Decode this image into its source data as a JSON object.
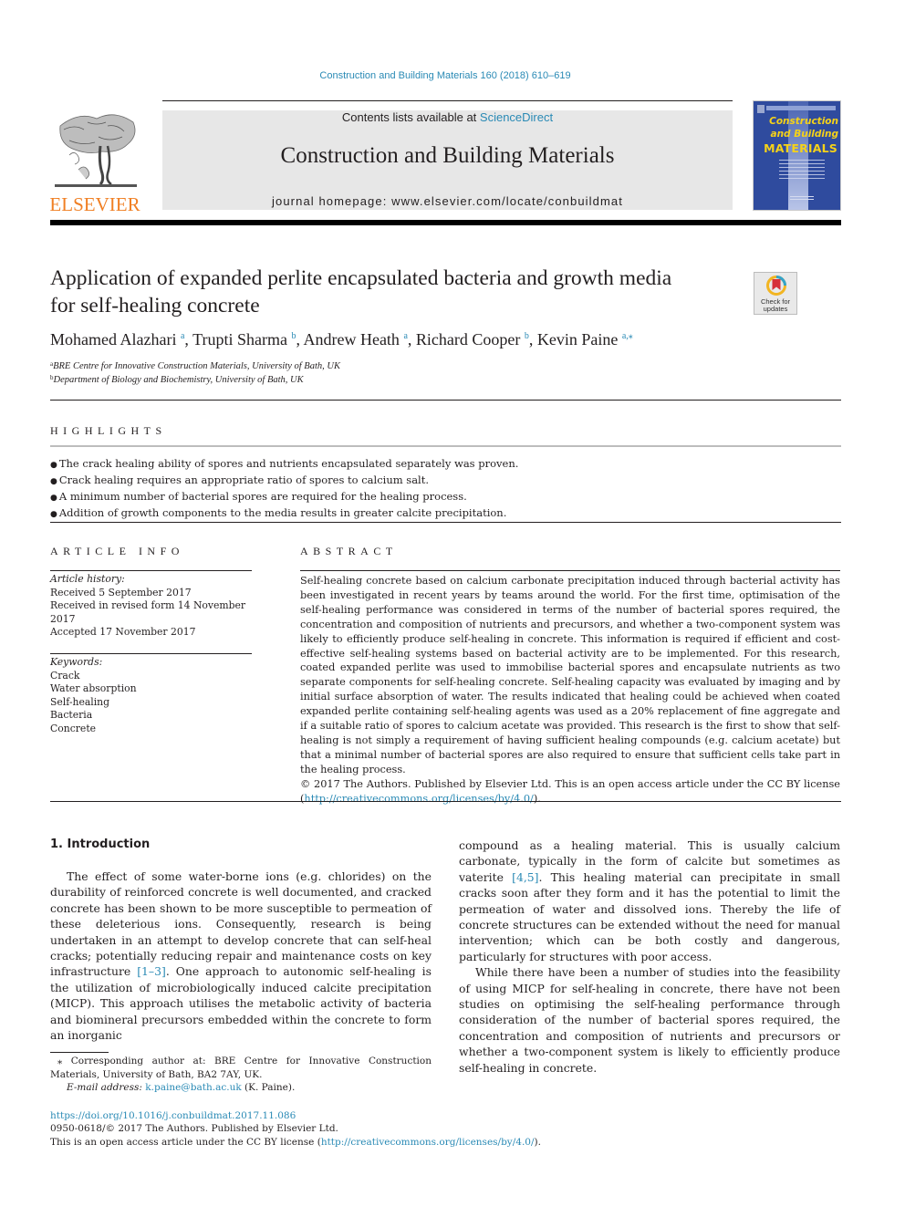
{
  "running_head": "Construction and Building Materials 160 (2018) 610–619",
  "masthead": {
    "contents_prefix": "Contents lists available at ",
    "contents_link": "ScienceDirect",
    "journal_name": "Construction and Building Materials",
    "homepage": "journal homepage: www.elsevier.com/locate/conbuildmat",
    "publisher_logo_text": "ELSEVIER",
    "cover": {
      "title_line1": "Construction",
      "title_line2": "and Building",
      "title_line3": "MATERIALS"
    }
  },
  "colors": {
    "link": "#2a8ab5",
    "elsevier_orange": "#f07f23",
    "cover_blue": "#2f4b9e",
    "cover_yellow": "#f5d219",
    "masthead_grey": "#e7e7e7"
  },
  "check_updates": {
    "line1": "Check for",
    "line2": "updates"
  },
  "article": {
    "title_line1": "Application of expanded perlite encapsulated bacteria and growth media",
    "title_line2": "for self-healing concrete",
    "authors": [
      {
        "name": "Mohamed Alazhari",
        "sup": "a"
      },
      {
        "name": "Trupti Sharma",
        "sup": "b"
      },
      {
        "name": "Andrew Heath",
        "sup": "a"
      },
      {
        "name": "Richard Cooper",
        "sup": "b"
      },
      {
        "name": "Kevin Paine",
        "sup": "a,⁎"
      }
    ],
    "affiliations": [
      {
        "sup": "a",
        "text": "BRE Centre for Innovative Construction Materials, University of Bath, UK"
      },
      {
        "sup": "b",
        "text": "Department of Biology and Biochemistry, University of Bath, UK"
      }
    ]
  },
  "highlights": {
    "label": "HIGHLIGHTS",
    "items": [
      "The crack healing ability of spores and nutrients encapsulated separately was proven.",
      "Crack healing requires an appropriate ratio of spores to calcium salt.",
      "A minimum number of bacterial spores are required for the healing process.",
      "Addition of growth components to the media results in greater calcite precipitation."
    ]
  },
  "article_info": {
    "label": "ARTICLE INFO",
    "history_label": "Article history:",
    "history": [
      "Received 5 September 2017",
      "Received in revised form 14 November 2017",
      "Accepted 17 November 2017"
    ],
    "keywords_label": "Keywords:",
    "keywords": [
      "Crack",
      "Water absorption",
      "Self-healing",
      "Bacteria",
      "Concrete"
    ]
  },
  "abstract": {
    "label": "ABSTRACT",
    "text": "Self-healing concrete based on calcium carbonate precipitation induced through bacterial activity has been investigated in recent years by teams around the world. For the first time, optimisation of the self-healing performance was considered in terms of the number of bacterial spores required, the concentration and composition of nutrients and precursors, and whether a two-component system was likely to efficiently produce self-healing in concrete. This information is required if efficient and cost-effective self-healing systems based on bacterial activity are to be implemented. For this research, coated expanded perlite was used to immobilise bacterial spores and encapsulate nutrients as two separate components for self-healing concrete. Self-healing capacity was evaluated by imaging and by initial surface absorption of water. The results indicated that healing could be achieved when coated expanded perlite containing self-healing agents was used as a 20% replacement of fine aggregate and if a suitable ratio of spores to calcium acetate was provided. This research is the first to show that self-healing is not simply a requirement of having sufficient healing compounds (e.g. calcium acetate) but that a minimal number of bacterial spores are also required to ensure that sufficient cells take part in the healing process.",
    "license_prefix": "© 2017 The Authors. Published by Elsevier Ltd. This is an open access article under the CC BY license (",
    "license_link": "http://creativecommons.org/licenses/by/4.0/",
    "license_suffix": ")."
  },
  "introduction": {
    "heading": "1. Introduction",
    "p1_a": "The effect of some water-borne ions (e.g. chlorides) on the durability of reinforced concrete is well documented, and cracked concrete has been shown to be more susceptible to permeation of these deleterious ions. Consequently, research is being undertaken in an attempt to develop concrete that can self-heal cracks; potentially reducing repair and maintenance costs on key infrastructure ",
    "p1_ref1": "[1–3]",
    "p1_b": ". One approach to autonomic self-healing is the utilization of microbiologically induced calcite precipitation (MICP). This approach utilises the metabolic activity of bacteria and biomineral precursors embedded within the concrete to form an inorganic",
    "p1_c": "compound as a healing material. This is usually calcium carbonate, typically in the form of calcite but sometimes as vaterite ",
    "p1_ref2": "[4,5]",
    "p1_d": ". This healing material can precipitate in small cracks soon after they form and it has the potential to limit the permeation of water and dissolved ions. Thereby the life of concrete structures can be extended without the need for manual intervention; which can be both costly and dangerous, particularly for structures with poor access.",
    "p2": "While there have been a number of studies into the feasibility of using MICP for self-healing in concrete, there have not been studies on optimising the self-healing performance through consideration of the number of bacterial spores required, the concentration and composition of nutrients and precursors or whether a two-component system is likely to efficiently produce self-healing in concrete."
  },
  "footnote": {
    "corresponding": "⁎ Corresponding author at: BRE Centre for Innovative Construction Materials, University of Bath, BA2 7AY, UK.",
    "email_label": "E-mail address: ",
    "email": "k.paine@bath.ac.uk",
    "email_suffix": " (K. Paine)."
  },
  "bottom": {
    "doi": "https://doi.org/10.1016/j.conbuildmat.2017.11.086",
    "issn_line": "0950-0618/© 2017 The Authors. Published by Elsevier Ltd.",
    "oa_prefix": "This is an open access article under the CC BY license (",
    "oa_link": "http://creativecommons.org/licenses/by/4.0/",
    "oa_suffix": ")."
  }
}
